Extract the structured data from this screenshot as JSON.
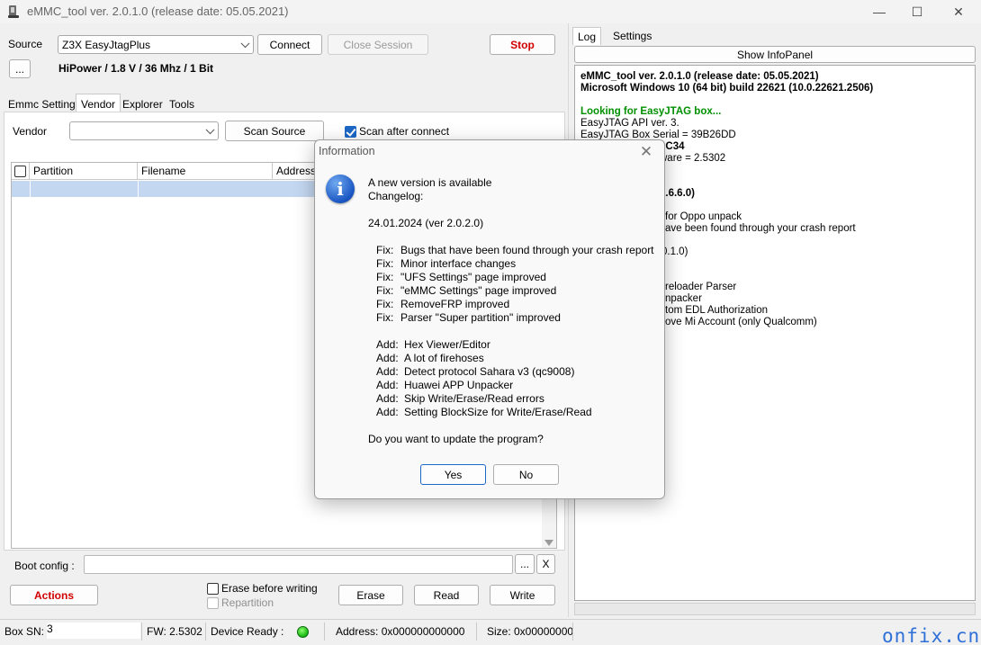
{
  "window": {
    "title": "eMMC_tool ver. 2.0.1.0 (release date: 05.05.2021)",
    "minimize_glyph": "—",
    "maximize_glyph": "☐",
    "close_glyph": "✕"
  },
  "left": {
    "source_label": "Source",
    "source_value": "Z3X EasyJtagPlus",
    "connect": "Connect",
    "close_session": "Close Session",
    "stop": "Stop",
    "more": "...",
    "power_info": "HiPower / 1.8 V / 36 Mhz / 1 Bit",
    "tabs": [
      "Emmc Settings",
      "Vendor",
      "Explorer",
      "Tools"
    ],
    "vendor_label": "Vendor",
    "vendor_value": "",
    "scan_source": "Scan Source",
    "scan_after_connect": "Scan after connect",
    "grid_headers": [
      "Partition",
      "Filename",
      "Address"
    ],
    "boot_config_label": "Boot config :",
    "boot_more": "...",
    "boot_clear": "X",
    "actions": "Actions",
    "erase_before_writing": "Erase before writing",
    "repartition": "Repartition",
    "erase": "Erase",
    "read": "Read",
    "write": "Write"
  },
  "right": {
    "tabs": [
      "Log",
      "Settings"
    ],
    "show_infopanel": "Show InfoPanel",
    "log_lines": [
      {
        "text": "eMMC_tool ver. 2.0.1.0 (release date: 05.05.2021)",
        "style": "bold"
      },
      {
        "text": "Microsoft Windows 10 (64 bit) build 22621 (10.0.22621.2506)",
        "style": "bold"
      },
      {
        "text": "",
        "style": ""
      },
      {
        "text": "Looking for EasyJTAG box...",
        "style": "green"
      },
      {
        "text": "EasyJTAG API ver. 3.",
        "style": ""
      },
      {
        "text": "EasyJTAG Box Serial = 39B26DD",
        "style": "mixed"
      },
      {
        "text": "9C34",
        "style": "bold"
      },
      {
        "text": "ware = 2.5302",
        "style": "mixed2"
      },
      {
        "text": "",
        "style": ""
      },
      {
        "text": "",
        "style": ""
      },
      {
        "text": " 1.6.6.0)",
        "style": "bold"
      },
      {
        "text": "",
        "style": ""
      },
      {
        "text": "for Oppo unpack",
        "style": ""
      },
      {
        "text": "ave been found through your crash report",
        "style": ""
      },
      {
        "text": "",
        "style": ""
      },
      {
        "text": "0.1.0)",
        "style": ""
      },
      {
        "text": "",
        "style": ""
      },
      {
        "text": "",
        "style": ""
      },
      {
        "text": "reloader Parser",
        "style": ""
      },
      {
        "text": "npacker",
        "style": ""
      },
      {
        "text": "tom EDL Authorization",
        "style": ""
      },
      {
        "text": "ove Mi Account (only Qualcomm)",
        "style": ""
      }
    ]
  },
  "status": {
    "box_sn_label": "Box SN:",
    "box_sn_value": "3",
    "fw": "FW:  2.5302",
    "device_ready": "Device Ready :",
    "address": "Address: 0x000000000000",
    "size": "Size: 0x00000000"
  },
  "dialog": {
    "title": "Information",
    "close": "✕",
    "icon": "i",
    "line1": "A new version is available",
    "line2": "Changelog:",
    "version": "24.01.2024 (ver 2.0.2.0)",
    "fixes": [
      "Bugs that have been found through your crash report",
      "Minor interface changes",
      "\"UFS Settings\" page improved",
      "\"eMMC Settings\" page improved",
      "RemoveFRP improved",
      "Parser \"Super partition\" improved"
    ],
    "fix_prefix": "Fix:",
    "adds": [
      "Hex Viewer/Editor",
      "A lot of firehoses",
      "Detect protocol Sahara v3 (qc9008)",
      "Huawei APP Unpacker",
      "Skip Write/Erase/Read errors",
      "Setting BlockSize for Write/Erase/Read"
    ],
    "add_prefix": "Add:",
    "question": "Do you want to update the program?",
    "yes": "Yes",
    "no": "No"
  },
  "watermark": "onfix.cn",
  "colors": {
    "accent": "#1c68c5",
    "selection": "#c3d7f0",
    "stop_red": "#d00000",
    "log_green": "#009000",
    "ready_led": "#17b515"
  }
}
